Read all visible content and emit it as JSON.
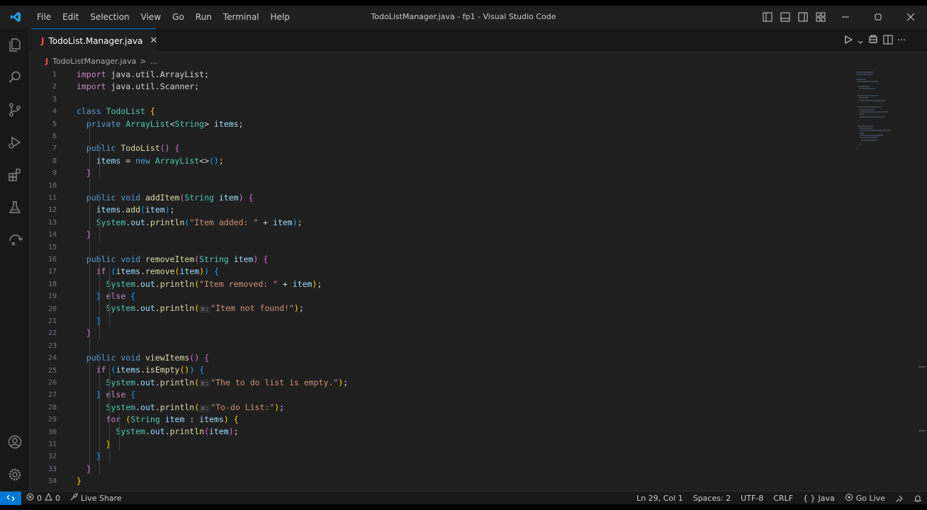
{
  "titlebar": {
    "menu": [
      "File",
      "Edit",
      "Selection",
      "View",
      "Go",
      "Run",
      "Terminal",
      "Help"
    ],
    "title": "TodoListManager.java - fp1 - Visual Studio Code"
  },
  "tab": {
    "icon_letter": "J",
    "label": "TodoList.Manager.java"
  },
  "breadcrumb": {
    "icon_letter": "J",
    "file": "TodoListManager.java",
    "sep": ">",
    "more": "..."
  },
  "code": {
    "line_numbers": [
      "1",
      "2",
      "3",
      "4",
      "5",
      "6",
      "7",
      "8",
      "9",
      "10",
      "11",
      "12",
      "13",
      "14",
      "15",
      "16",
      "17",
      "18",
      "19",
      "20",
      "21",
      "22",
      "23",
      "24",
      "25",
      "26",
      "27",
      "28",
      "29",
      "30",
      "31",
      "32",
      "33",
      "34"
    ],
    "lines": [
      [
        [
          "kw2",
          "import"
        ],
        [
          "pl",
          " java.util.ArrayList;"
        ]
      ],
      [
        [
          "kw2",
          "import"
        ],
        [
          "pl",
          " java.util.Scanner;"
        ]
      ],
      [],
      [
        [
          "kw",
          "class"
        ],
        [
          "pl",
          " "
        ],
        [
          "ty",
          "TodoList"
        ],
        [
          "pl",
          " "
        ],
        [
          "br1",
          "{"
        ]
      ],
      [
        [
          "pl",
          "  "
        ],
        [
          "kw",
          "private"
        ],
        [
          "pl",
          " "
        ],
        [
          "ty",
          "ArrayList"
        ],
        [
          "pl",
          "<"
        ],
        [
          "ty",
          "String"
        ],
        [
          "pl",
          "> "
        ],
        [
          "var",
          "items"
        ],
        [
          "pl",
          ";"
        ]
      ],
      [],
      [
        [
          "pl",
          "  "
        ],
        [
          "kw",
          "public"
        ],
        [
          "pl",
          " "
        ],
        [
          "fn",
          "TodoList"
        ],
        [
          "br2",
          "()"
        ],
        [
          "pl",
          " "
        ],
        [
          "br2",
          "{"
        ]
      ],
      [
        [
          "pl",
          "    "
        ],
        [
          "var",
          "items"
        ],
        [
          "pl",
          " = "
        ],
        [
          "kw",
          "new"
        ],
        [
          "pl",
          " "
        ],
        [
          "ty",
          "ArrayList"
        ],
        [
          "pl",
          "<>"
        ],
        [
          "br3",
          "()"
        ],
        [
          "pl",
          ";"
        ]
      ],
      [
        [
          "pl",
          "  "
        ],
        [
          "br2",
          "}"
        ]
      ],
      [],
      [
        [
          "pl",
          "  "
        ],
        [
          "kw",
          "public"
        ],
        [
          "pl",
          " "
        ],
        [
          "kw",
          "void"
        ],
        [
          "pl",
          " "
        ],
        [
          "fn",
          "addItem"
        ],
        [
          "br2",
          "("
        ],
        [
          "ty",
          "String"
        ],
        [
          "pl",
          " "
        ],
        [
          "var",
          "item"
        ],
        [
          "br2",
          ")"
        ],
        [
          "pl",
          " "
        ],
        [
          "br2",
          "{"
        ]
      ],
      [
        [
          "pl",
          "    "
        ],
        [
          "var",
          "items"
        ],
        [
          "pl",
          "."
        ],
        [
          "fn",
          "add"
        ],
        [
          "br3",
          "("
        ],
        [
          "var",
          "item"
        ],
        [
          "br3",
          ")"
        ],
        [
          "pl",
          ";"
        ]
      ],
      [
        [
          "pl",
          "    "
        ],
        [
          "ty",
          "System"
        ],
        [
          "pl",
          "."
        ],
        [
          "var",
          "out"
        ],
        [
          "pl",
          "."
        ],
        [
          "fn",
          "println"
        ],
        [
          "br3",
          "("
        ],
        [
          "str",
          "\"Item added: \""
        ],
        [
          "pl",
          " + "
        ],
        [
          "var",
          "item"
        ],
        [
          "br3",
          ")"
        ],
        [
          "pl",
          ";"
        ]
      ],
      [
        [
          "pl",
          "  "
        ],
        [
          "br2",
          "}"
        ]
      ],
      [],
      [
        [
          "pl",
          "  "
        ],
        [
          "kw",
          "public"
        ],
        [
          "pl",
          " "
        ],
        [
          "kw",
          "void"
        ],
        [
          "pl",
          " "
        ],
        [
          "fn",
          "removeItem"
        ],
        [
          "br2",
          "("
        ],
        [
          "ty",
          "String"
        ],
        [
          "pl",
          " "
        ],
        [
          "var",
          "item"
        ],
        [
          "br2",
          ")"
        ],
        [
          "pl",
          " "
        ],
        [
          "br2",
          "{"
        ]
      ],
      [
        [
          "pl",
          "    "
        ],
        [
          "kw2",
          "if"
        ],
        [
          "pl",
          " "
        ],
        [
          "br3",
          "("
        ],
        [
          "var",
          "items"
        ],
        [
          "pl",
          "."
        ],
        [
          "fn",
          "remove"
        ],
        [
          "br1",
          "("
        ],
        [
          "var",
          "item"
        ],
        [
          "br1",
          ")"
        ],
        [
          "br3",
          ")"
        ],
        [
          "pl",
          " "
        ],
        [
          "br3",
          "{"
        ]
      ],
      [
        [
          "pl",
          "      "
        ],
        [
          "ty",
          "System"
        ],
        [
          "pl",
          "."
        ],
        [
          "var",
          "out"
        ],
        [
          "pl",
          "."
        ],
        [
          "fn",
          "println"
        ],
        [
          "br1",
          "("
        ],
        [
          "str",
          "\"Item removed: \""
        ],
        [
          "pl",
          " + "
        ],
        [
          "var",
          "item"
        ],
        [
          "br1",
          ")"
        ],
        [
          "pl",
          ";"
        ]
      ],
      [
        [
          "pl",
          "    "
        ],
        [
          "br3",
          "}"
        ],
        [
          "pl",
          " "
        ],
        [
          "kw2",
          "else"
        ],
        [
          "pl",
          " "
        ],
        [
          "br3",
          "{"
        ]
      ],
      [
        [
          "pl",
          "      "
        ],
        [
          "ty",
          "System"
        ],
        [
          "pl",
          "."
        ],
        [
          "var",
          "out"
        ],
        [
          "pl",
          "."
        ],
        [
          "fn",
          "println"
        ],
        [
          "br1",
          "("
        ],
        [
          "hint",
          "x:"
        ],
        [
          "str",
          "\"Item not found!\""
        ],
        [
          "br1",
          ")"
        ],
        [
          "pl",
          ";"
        ]
      ],
      [
        [
          "pl",
          "    "
        ],
        [
          "br3",
          "}"
        ]
      ],
      [
        [
          "pl",
          "  "
        ],
        [
          "br2",
          "}"
        ]
      ],
      [],
      [
        [
          "pl",
          "  "
        ],
        [
          "kw",
          "public"
        ],
        [
          "pl",
          " "
        ],
        [
          "kw",
          "void"
        ],
        [
          "pl",
          " "
        ],
        [
          "fn",
          "viewItems"
        ],
        [
          "br2",
          "()"
        ],
        [
          "pl",
          " "
        ],
        [
          "br2",
          "{"
        ]
      ],
      [
        [
          "pl",
          "    "
        ],
        [
          "kw2",
          "if"
        ],
        [
          "pl",
          " "
        ],
        [
          "br3",
          "("
        ],
        [
          "var",
          "items"
        ],
        [
          "pl",
          "."
        ],
        [
          "fn",
          "isEmpty"
        ],
        [
          "br1",
          "()"
        ],
        [
          "br3",
          ")"
        ],
        [
          "pl",
          " "
        ],
        [
          "br3",
          "{"
        ]
      ],
      [
        [
          "pl",
          "      "
        ],
        [
          "ty",
          "System"
        ],
        [
          "pl",
          "."
        ],
        [
          "var",
          "out"
        ],
        [
          "pl",
          "."
        ],
        [
          "fn",
          "println"
        ],
        [
          "br1",
          "("
        ],
        [
          "hint",
          "x:"
        ],
        [
          "str",
          "\"The to do list is empty.\""
        ],
        [
          "br1",
          ")"
        ],
        [
          "pl",
          ";"
        ]
      ],
      [
        [
          "pl",
          "    "
        ],
        [
          "br3",
          "}"
        ],
        [
          "pl",
          " "
        ],
        [
          "kw2",
          "else"
        ],
        [
          "pl",
          " "
        ],
        [
          "br3",
          "{"
        ]
      ],
      [
        [
          "pl",
          "      "
        ],
        [
          "ty",
          "System"
        ],
        [
          "pl",
          "."
        ],
        [
          "var",
          "out"
        ],
        [
          "pl",
          "."
        ],
        [
          "fn",
          "println"
        ],
        [
          "br1",
          "("
        ],
        [
          "hint",
          "x:"
        ],
        [
          "str",
          "\"To-do List:\""
        ],
        [
          "br1",
          ")"
        ],
        [
          "pl",
          ";"
        ]
      ],
      [
        [
          "pl",
          "      "
        ],
        [
          "kw2",
          "for"
        ],
        [
          "pl",
          " "
        ],
        [
          "br1",
          "("
        ],
        [
          "ty",
          "String"
        ],
        [
          "pl",
          " "
        ],
        [
          "var",
          "item"
        ],
        [
          "pl",
          " : "
        ],
        [
          "var",
          "items"
        ],
        [
          "br1",
          ")"
        ],
        [
          "pl",
          " "
        ],
        [
          "br1",
          "{"
        ]
      ],
      [
        [
          "pl",
          "        "
        ],
        [
          "ty",
          "System"
        ],
        [
          "pl",
          "."
        ],
        [
          "var",
          "out"
        ],
        [
          "pl",
          "."
        ],
        [
          "fn",
          "println"
        ],
        [
          "br2",
          "("
        ],
        [
          "var",
          "item"
        ],
        [
          "br2",
          ")"
        ],
        [
          "pl",
          ";"
        ]
      ],
      [
        [
          "pl",
          "      "
        ],
        [
          "br1",
          "}"
        ]
      ],
      [
        [
          "pl",
          "    "
        ],
        [
          "br3",
          "}"
        ]
      ],
      [
        [
          "pl",
          "  "
        ],
        [
          "br2",
          "}"
        ]
      ],
      [
        [
          "br1",
          "}"
        ]
      ]
    ]
  },
  "statusbar": {
    "errors": "0",
    "warnings": "0",
    "live_share": "Live Share",
    "position": "Ln 29, Col 1",
    "spaces": "Spaces: 2",
    "encoding": "UTF-8",
    "eol": "CRLF",
    "language": "Java",
    "golive": "Go Live"
  }
}
